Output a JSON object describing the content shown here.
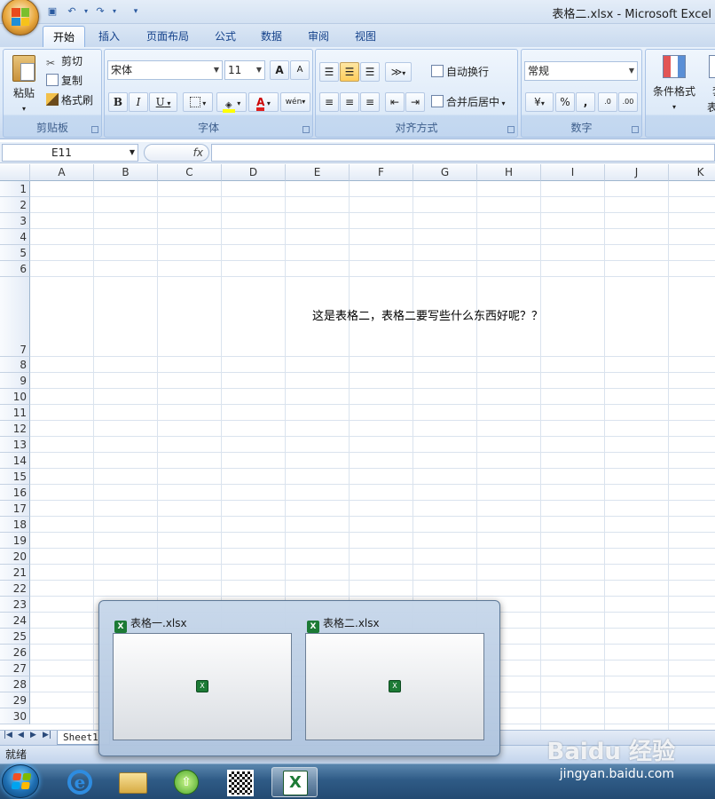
{
  "window": {
    "title": "表格二.xlsx - Microsoft Excel"
  },
  "ribbon_tabs": [
    "开始",
    "插入",
    "页面布局",
    "公式",
    "数据",
    "审阅",
    "视图"
  ],
  "clipboard": {
    "paste": "粘贴",
    "cut": "剪切",
    "copy": "复制",
    "format_painter": "格式刷",
    "label": "剪贴板"
  },
  "font": {
    "name": "宋体",
    "size": "11",
    "label": "字体",
    "bold": "B",
    "italic": "I",
    "underline": "U",
    "grow": "A",
    "shrink": "A"
  },
  "alignment": {
    "wrap_text": "自动换行",
    "merge_center": "合并后居中",
    "label": "对齐方式"
  },
  "number": {
    "format": "常规",
    "percent": "%",
    "comma": ",",
    "label": "数字"
  },
  "styles": {
    "conditional_format": "条件格式",
    "table_format_partial_1": "套",
    "table_format_partial_2": "表格"
  },
  "formula_bar": {
    "name_box": "E11",
    "fx": "fx",
    "value": ""
  },
  "grid": {
    "columns": [
      "A",
      "B",
      "C",
      "D",
      "E",
      "F",
      "G",
      "H",
      "I",
      "J",
      "K"
    ],
    "rows": [
      "1",
      "2",
      "3",
      "4",
      "5",
      "6",
      "7",
      "8",
      "9",
      "10",
      "11",
      "12",
      "13",
      "14",
      "15",
      "16",
      "17",
      "18",
      "19",
      "20",
      "21",
      "22",
      "23",
      "24",
      "25",
      "26",
      "27",
      "28",
      "29",
      "30"
    ],
    "cell_text": "这是表格二，表格二要写些什么东西好呢？？"
  },
  "sheet_tab": "Sheet1",
  "status": "就绪",
  "thumbnails": [
    {
      "title": "表格一.xlsx"
    },
    {
      "title": "表格二.xlsx"
    }
  ],
  "watermark": {
    "main": "Baidu 经验",
    "sub": "jingyan.baidu.com"
  },
  "colors": {
    "excel_green": "#1c7a35",
    "ribbon_blue": "#15428b",
    "taskbar": "#2f5b86"
  }
}
